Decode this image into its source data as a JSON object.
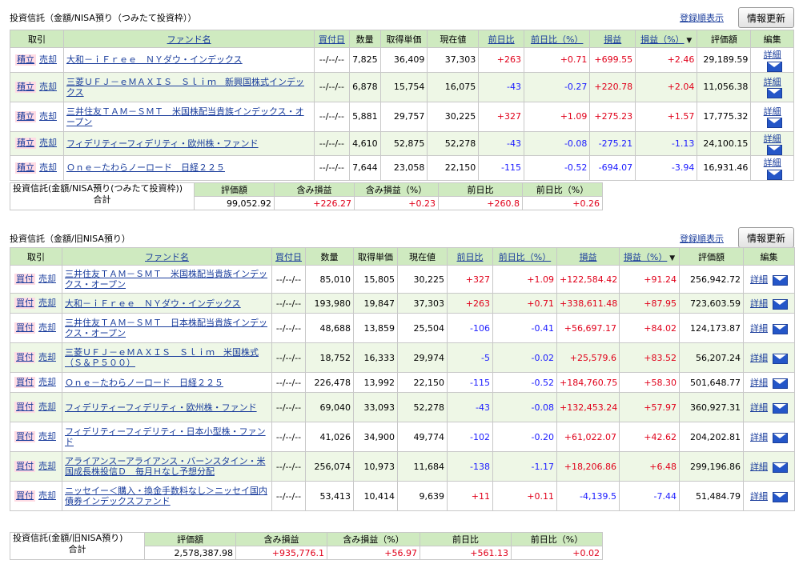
{
  "section1": {
    "title": "投資信託（金額/NISA預り（つみたて投資枠））",
    "link": "登録順表示",
    "refresh": "情報更新",
    "headers": [
      "取引",
      "ファンド名",
      "買付日",
      "数量",
      "取得単価",
      "現在値",
      "前日比",
      "前日比（%）",
      "損益",
      "損益（%）",
      "評価額",
      "編集"
    ],
    "rows": [
      {
        "tx": "積立",
        "sell": "売却",
        "fund": "大和－ｉＦｒｅｅ　ＮＹダウ・インデックス",
        "date": "--/--/--",
        "qty": "7,825",
        "cost": "36,409",
        "price": "37,303",
        "chg": "+263",
        "chgp": "+0.71",
        "pl": "+699.55",
        "plp": "+2.46",
        "val": "29,189.59",
        "detail": "詳細"
      },
      {
        "tx": "積立",
        "sell": "売却",
        "fund": "三菱ＵＦＪ－ｅＭＡＸＩＳ　Ｓｌｉｍ　新興国株式インデックス",
        "date": "--/--/--",
        "qty": "6,878",
        "cost": "15,754",
        "price": "16,075",
        "chg": "-43",
        "chgp": "-0.27",
        "pl": "+220.78",
        "plp": "+2.04",
        "val": "11,056.38",
        "detail": "詳細"
      },
      {
        "tx": "積立",
        "sell": "売却",
        "fund": "三井住友ＴＡＭ－ＳＭＴ　米国株配当貴族インデックス・オープン",
        "date": "--/--/--",
        "qty": "5,881",
        "cost": "29,757",
        "price": "30,225",
        "chg": "+327",
        "chgp": "+1.09",
        "pl": "+275.23",
        "plp": "+1.57",
        "val": "17,775.32",
        "detail": "詳細"
      },
      {
        "tx": "積立",
        "sell": "売却",
        "fund": "フィデリティーフィデリティ・欧州株・ファンド",
        "date": "--/--/--",
        "qty": "4,610",
        "cost": "52,875",
        "price": "52,278",
        "chg": "-43",
        "chgp": "-0.08",
        "pl": "-275.21",
        "plp": "-1.13",
        "val": "24,100.15",
        "detail": "詳細"
      },
      {
        "tx": "積立",
        "sell": "売却",
        "fund": "Ｏｎｅ－たわらノーロード　日経２２５",
        "date": "--/--/--",
        "qty": "7,644",
        "cost": "23,058",
        "price": "22,150",
        "chg": "-115",
        "chgp": "-0.52",
        "pl": "-694.07",
        "plp": "-3.94",
        "val": "16,931.46",
        "detail": "詳細"
      }
    ],
    "summary": {
      "label": "投資信託(金額/NISA預り(つみたて投資枠))",
      "sublabel": "合計",
      "headers": [
        "評価額",
        "含み損益",
        "含み損益（%）",
        "前日比",
        "前日比（%）"
      ],
      "values": [
        "99,052.92",
        "+226.27",
        "+0.23",
        "+260.8",
        "+0.26"
      ]
    }
  },
  "section2": {
    "title": "投資信託（金額/旧NISA預り）",
    "link": "登録順表示",
    "refresh": "情報更新",
    "headers": [
      "取引",
      "ファンド名",
      "買付日",
      "数量",
      "取得単価",
      "現在値",
      "前日比",
      "前日比（%）",
      "損益",
      "損益（%）",
      "評価額",
      "編集"
    ],
    "rows": [
      {
        "tx": "買付",
        "sell": "売却",
        "fund": "三井住友ＴＡＭ－ＳＭＴ　米国株配当貴族インデックス・オープン",
        "date": "--/--/--",
        "qty": "85,010",
        "cost": "15,805",
        "price": "30,225",
        "chg": "+327",
        "chgp": "+1.09",
        "pl": "+122,584.42",
        "plp": "+91.24",
        "val": "256,942.72",
        "detail": "詳細"
      },
      {
        "tx": "買付",
        "sell": "売却",
        "fund": "大和－ｉＦｒｅｅ　ＮＹダウ・インデックス",
        "date": "--/--/--",
        "qty": "193,980",
        "cost": "19,847",
        "price": "37,303",
        "chg": "+263",
        "chgp": "+0.71",
        "pl": "+338,611.48",
        "plp": "+87.95",
        "val": "723,603.59",
        "detail": "詳細"
      },
      {
        "tx": "買付",
        "sell": "売却",
        "fund": "三井住友ＴＡＭ－ＳＭＴ　日本株配当貴族インデックス・オープン",
        "date": "--/--/--",
        "qty": "48,688",
        "cost": "13,859",
        "price": "25,504",
        "chg": "-106",
        "chgp": "-0.41",
        "pl": "+56,697.17",
        "plp": "+84.02",
        "val": "124,173.87",
        "detail": "詳細"
      },
      {
        "tx": "買付",
        "sell": "売却",
        "fund": "三菱ＵＦＪ－ｅＭＡＸＩＳ　Ｓｌｉｍ　米国株式（Ｓ＆Ｐ５００）",
        "date": "--/--/--",
        "qty": "18,752",
        "cost": "16,333",
        "price": "29,974",
        "chg": "-5",
        "chgp": "-0.02",
        "pl": "+25,579.6",
        "plp": "+83.52",
        "val": "56,207.24",
        "detail": "詳細"
      },
      {
        "tx": "買付",
        "sell": "売却",
        "fund": "Ｏｎｅ－たわらノーロード　日経２２５",
        "date": "--/--/--",
        "qty": "226,478",
        "cost": "13,992",
        "price": "22,150",
        "chg": "-115",
        "chgp": "-0.52",
        "pl": "+184,760.75",
        "plp": "+58.30",
        "val": "501,648.77",
        "detail": "詳細"
      },
      {
        "tx": "買付",
        "sell": "売却",
        "fund": "フィデリティーフィデリティ・欧州株・ファンド",
        "date": "--/--/--",
        "qty": "69,040",
        "cost": "33,093",
        "price": "52,278",
        "chg": "-43",
        "chgp": "-0.08",
        "pl": "+132,453.24",
        "plp": "+57.97",
        "val": "360,927.31",
        "detail": "詳細"
      },
      {
        "tx": "買付",
        "sell": "売却",
        "fund": "フィデリティーフィデリティ・日本小型株・ファンド",
        "date": "--/--/--",
        "qty": "41,026",
        "cost": "34,900",
        "price": "49,774",
        "chg": "-102",
        "chgp": "-0.20",
        "pl": "+61,022.07",
        "plp": "+42.62",
        "val": "204,202.81",
        "detail": "詳細"
      },
      {
        "tx": "買付",
        "sell": "売却",
        "fund": "アライアンスーアライアンス・バーンスタイン・米国成長株投信Ｄ　毎月Ｈなし予想分配",
        "date": "--/--/--",
        "qty": "256,074",
        "cost": "10,973",
        "price": "11,684",
        "chg": "-138",
        "chgp": "-1.17",
        "pl": "+18,206.86",
        "plp": "+6.48",
        "val": "299,196.86",
        "detail": "詳細"
      },
      {
        "tx": "買付",
        "sell": "売却",
        "fund": "ニッセイー＜購入・換金手数料なし＞ニッセイ国内債券インデックスファンド",
        "date": "--/--/--",
        "qty": "53,413",
        "cost": "10,414",
        "price": "9,639",
        "chg": "+11",
        "chgp": "+0.11",
        "pl": "-4,139.5",
        "plp": "-7.44",
        "val": "51,484.79",
        "detail": "詳細"
      }
    ],
    "summary": {
      "label": "投資信託(金額/旧NISA預り)",
      "sublabel": "合計",
      "headers": [
        "評価額",
        "含み損益",
        "含み損益（%）",
        "前日比",
        "前日比（%）"
      ],
      "values": [
        "2,578,387.98",
        "+935,776.1",
        "+56.97",
        "+561.13",
        "+0.02"
      ]
    }
  },
  "sort_indicator": "▼"
}
